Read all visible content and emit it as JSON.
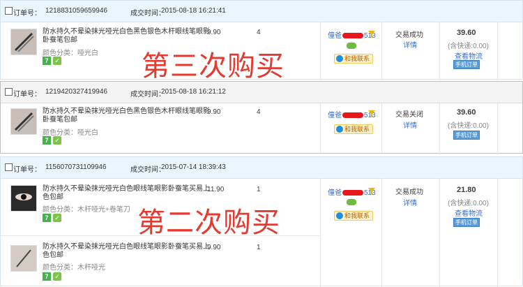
{
  "labels": {
    "order_no": "订单号：",
    "deal_time": "成交时间："
  },
  "orders": [
    {
      "order_number": "1218831059659946",
      "deal_time": "2015-08-18 16:21:41",
      "items": [
        {
          "name": "防水持久不晕染抹光哑光白色黑色银色木杆眼线笔眼影卧蚕笔包邮",
          "color": "颜色分类：哑光白",
          "price": "9.90",
          "qty": "4"
        }
      ],
      "seller": {
        "prefix": "僮爸",
        "suffix": "513"
      },
      "contact": "和我联系",
      "status": "交易成功",
      "detail": "详情",
      "amount": "39.60",
      "shipping": "(含快递:0.00)",
      "logistics": "查看物流",
      "mobile_order": "手机订单"
    },
    {
      "order_number": "1219420327419946",
      "deal_time": "2015-08-18 16:21:12",
      "items": [
        {
          "name": "防水持久不晕染抹光哑光白色黑色银色木杆眼线笔眼影卧蚕笔包邮",
          "color": "颜色分类：哑光白",
          "price": "9.90",
          "qty": "4"
        }
      ],
      "seller": {
        "prefix": "僮爸",
        "suffix": "513"
      },
      "contact": "和我联系",
      "status": "交易关闭",
      "detail": "详情",
      "amount": "39.60",
      "shipping": "(含快递:0.00)",
      "logistics": "",
      "mobile_order": "手机订单"
    },
    {
      "order_number": "1156070731109946",
      "deal_time": "2015-07-14 18:39:43",
      "items": [
        {
          "name": "防水持久不晕染抹光哑光白色眼线笔眼影卧蚕笔买易上色包邮",
          "color": "颜色分类：木杆哑光+卷笔刀",
          "price": "11.90",
          "qty": "1"
        },
        {
          "name": "防水持久不晕染抹光哑光白色眼线笔眼影卧蚕笔买易上色包邮",
          "color": "颜色分类：木杆哑光",
          "price": "9.90",
          "qty": "1"
        }
      ],
      "seller": {
        "prefix": "僮爸",
        "suffix": "513"
      },
      "contact": "和我联系",
      "status": "交易成功",
      "detail": "详情",
      "amount": "21.80",
      "shipping": "(含快递:0.00)",
      "logistics": "查看物流",
      "mobile_order": "手机订单"
    }
  ],
  "overlays": {
    "third": "第三次购买",
    "second": "第二次购买"
  },
  "icons": {
    "seven_day": "7",
    "guarantee": "shield-icon"
  },
  "colors": {
    "header_bg": "#eaf6fe",
    "link": "#3a6dc4",
    "overlay_red": "#e53a2f"
  }
}
